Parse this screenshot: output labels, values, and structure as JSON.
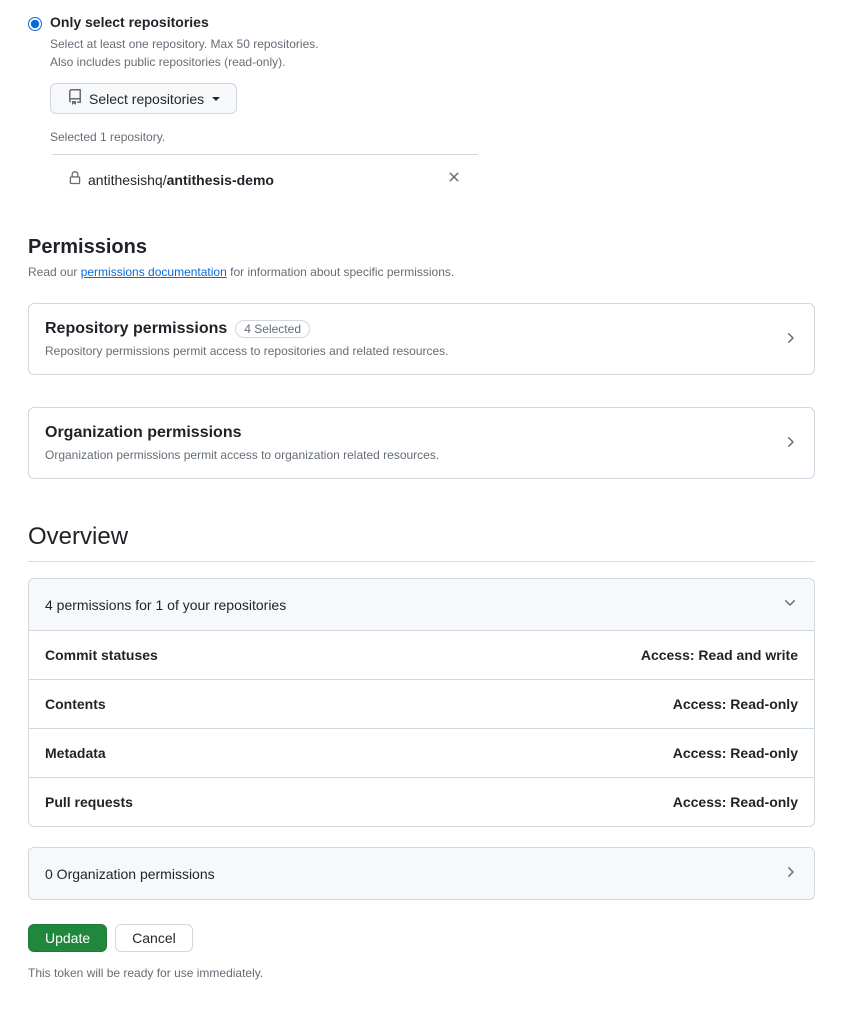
{
  "repoSelection": {
    "radioLabel": "Only select repositories",
    "desc1": "Select at least one repository. Max 50 repositories.",
    "desc2": "Also includes public repositories (read-only).",
    "selectButton": "Select repositories",
    "selectedCount": "Selected 1 repository.",
    "repoOwner": "antithesishq/",
    "repoName": "antithesis-demo"
  },
  "permissions": {
    "heading": "Permissions",
    "subPrefix": "Read our ",
    "subLink": "permissions documentation",
    "subSuffix": " for information about specific permissions.",
    "repoCard": {
      "title": "Repository permissions",
      "badge": "4 Selected",
      "desc": "Repository permissions permit access to repositories and related resources."
    },
    "orgCard": {
      "title": "Organization permissions",
      "desc": "Organization permissions permit access to organization related resources."
    }
  },
  "overview": {
    "heading": "Overview",
    "repoHeader": "4 permissions for 1 of your repositories",
    "rows": [
      {
        "name": "Commit statuses",
        "access": "Access: Read and write"
      },
      {
        "name": "Contents",
        "access": "Access: Read-only"
      },
      {
        "name": "Metadata",
        "access": "Access: Read-only"
      },
      {
        "name": "Pull requests",
        "access": "Access: Read-only"
      }
    ],
    "orgHeader": "0 Organization permissions"
  },
  "actions": {
    "update": "Update",
    "cancel": "Cancel",
    "note": "This token will be ready for use immediately."
  }
}
